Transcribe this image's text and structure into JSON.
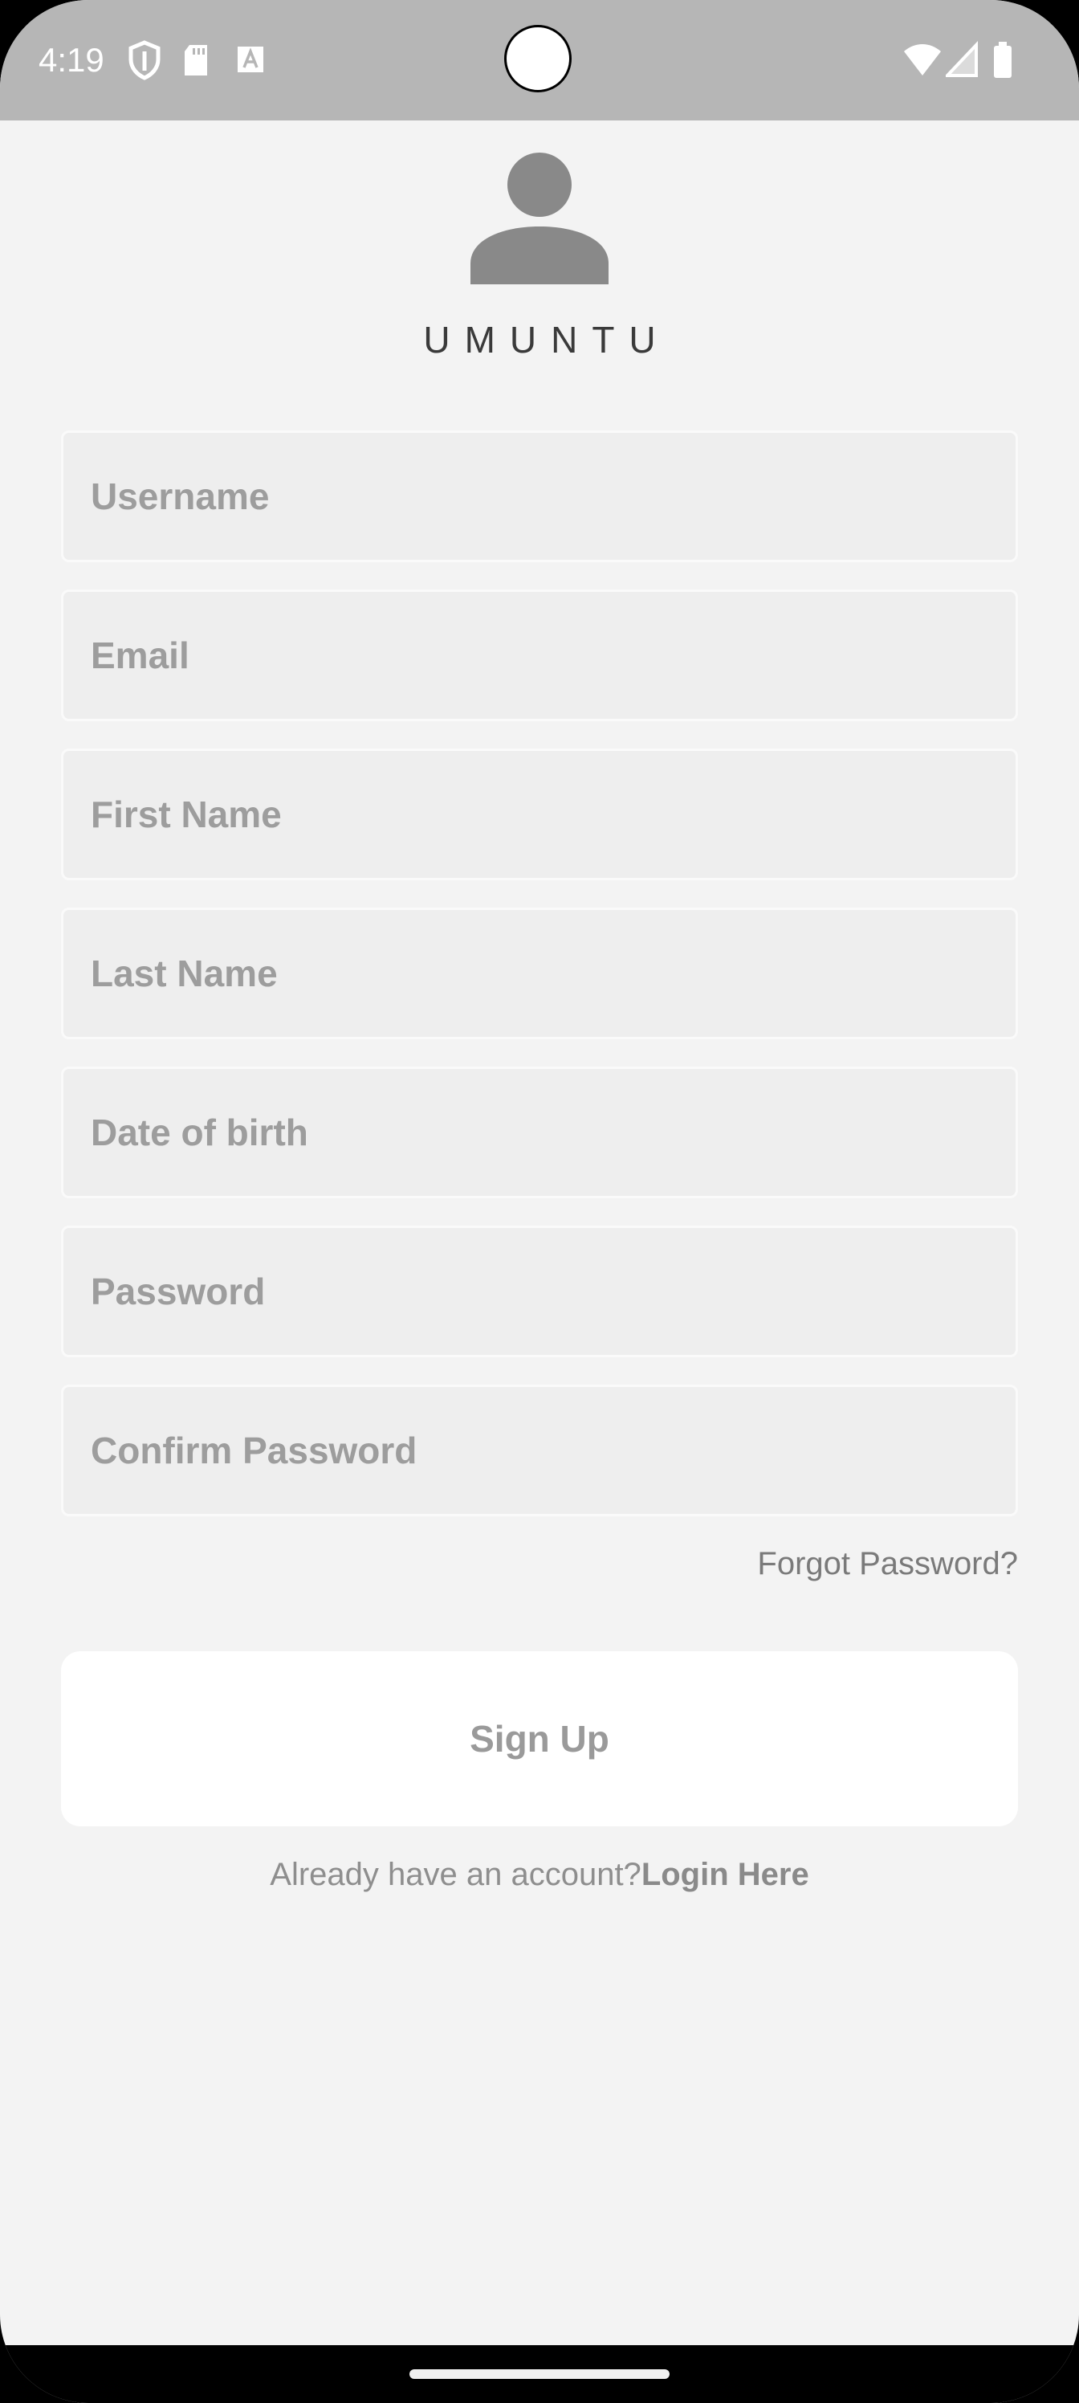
{
  "status_bar": {
    "time": "4:19",
    "icons_left": [
      "shield-icon",
      "sd-card-icon",
      "font-icon"
    ],
    "icons_right": [
      "wifi-icon",
      "signal-icon",
      "battery-icon"
    ]
  },
  "app": {
    "name": "UMUNTU",
    "logo_icon": "person-icon"
  },
  "form": {
    "username_placeholder": "Username",
    "email_placeholder": "Email",
    "first_name_placeholder": "First Name",
    "last_name_placeholder": "Last Name",
    "dob_placeholder": "Date of birth",
    "password_placeholder": "Password",
    "confirm_password_placeholder": "Confirm Password",
    "forgot_password": "Forgot Password?",
    "signup_label": "Sign Up",
    "login_prompt": "Already have an account?",
    "login_link": "Login Here"
  },
  "colors": {
    "status_bar": "#b6b6b6",
    "background": "#f3f3f3",
    "field_background": "#eeeeee",
    "button_background": "#ffffff"
  }
}
